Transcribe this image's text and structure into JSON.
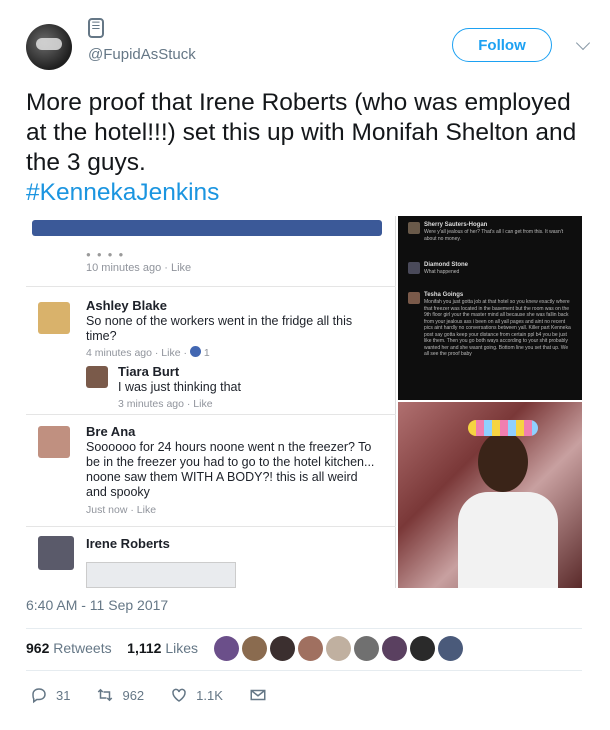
{
  "header": {
    "handle": "@FupidAsStuck",
    "follow_label": "Follow",
    "badge_glyph": "☰"
  },
  "tweet": {
    "text": "More proof that Irene Roberts (who was employed at the hotel!!!) set this up with Monifah Shelton and the 3 guys.",
    "hashtag": "#KennekaJenkins"
  },
  "media": {
    "left": {
      "first_time": "10 minutes ago · Like",
      "comments": [
        {
          "name": "Ashley Blake",
          "body": "So none of the workers went in the fridge all this time?",
          "meta": "4 minutes ago · Like ·",
          "likes": "1"
        },
        {
          "name": "Tiara Burt",
          "body": "I was just thinking that",
          "meta": "3 minutes ago · Like"
        },
        {
          "name": "Bre Ana",
          "body": "Soooooo for 24 hours noone went  n the freezer? To be in the freezer you had to go to the hotel kitchen... noone saw them WITH A BODY?! this is all weird and spooky",
          "meta": "Just now · Like"
        },
        {
          "name": "Irene Roberts"
        }
      ]
    },
    "right": {
      "comments": [
        {
          "name": "Sherry Sauters-Hogan",
          "text": "Were y'all jealous of her? That's all I can get from this. It wasn't about no money."
        },
        {
          "name": "Diamond Stone",
          "text": "What happened"
        },
        {
          "name": "Tesha Goings",
          "text": "Monifah you just gotta job at that hotel so you knew exactly where that freezer was located in the basement but the room was on the 9th floor girl your the master mind all because she was fallin back from your jealous ass i been on all yall pages and aint no recent pics aint hardly no conversations between yall. Killer part Kenneka post say gotta keep your distance from certain ppl b4 you be just like them. Then you go both ways according to your shit probably wanted her and she wasnt going. Bottom line you set that up. We all see the proof baby"
        }
      ]
    }
  },
  "timestamp": "6:40 AM - 11 Sep 2017",
  "stats": {
    "retweets_count": "962",
    "retweets_label": "Retweets",
    "likes_count": "1,112",
    "likes_label": "Likes"
  },
  "liker_colors": [
    "#6b4f8a",
    "#8a6b4f",
    "#3b2f2f",
    "#a07060",
    "#c0b0a0",
    "#707070",
    "#5a4060",
    "#2a2a2a",
    "#4a5a7a"
  ],
  "actions": {
    "reply_count": "31",
    "retweet_count": "962",
    "like_count": "1.1K"
  },
  "colors": {
    "accent": "#1da1f2",
    "hashtag": "#1b95e0",
    "secondary_text": "#657786"
  }
}
